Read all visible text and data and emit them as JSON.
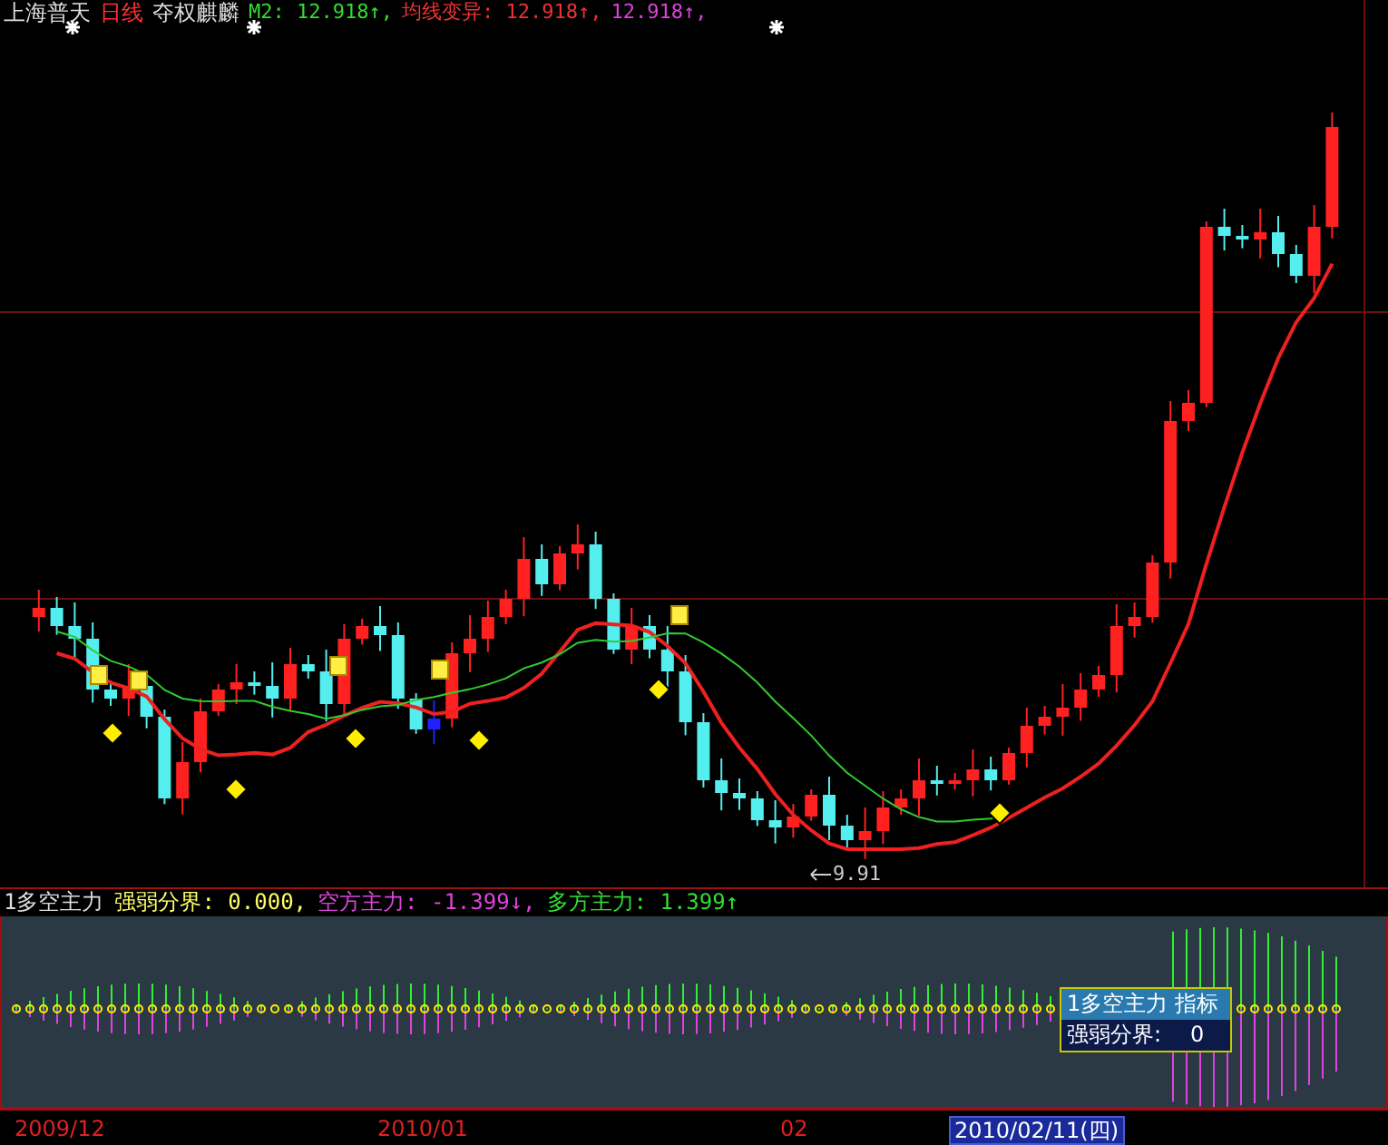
{
  "header": {
    "stock": "上海普天",
    "period": "日线",
    "formula": "夺权麒麟",
    "values": [
      {
        "text": "M2: 12.918↑,",
        "color": "#33dd33"
      },
      {
        "text": "均线变异: 12.918↑,",
        "color": "#ee3333"
      },
      {
        "text": "12.918↑,",
        "color": "#dd44dd"
      }
    ]
  },
  "low_label": "9.91",
  "indicator": {
    "name": "1多空主力",
    "values": [
      {
        "text": "强弱分界: 0.000,",
        "color": "#ffff66"
      },
      {
        "text": "空方主力: -1.399↓,",
        "color": "#dd44dd"
      },
      {
        "text": "多方主力: 1.399↑",
        "color": "#33dd33"
      }
    ]
  },
  "tooltip": {
    "title": "1多空主力 指标",
    "label": "强弱分界:",
    "value": "0"
  },
  "axis_labels": [
    {
      "text": "2009/12",
      "selected": false
    },
    {
      "text": "2010/01",
      "selected": false
    },
    {
      "text": "02",
      "selected": false
    },
    {
      "text": "2010/02/11(四)",
      "selected": true
    }
  ]
}
